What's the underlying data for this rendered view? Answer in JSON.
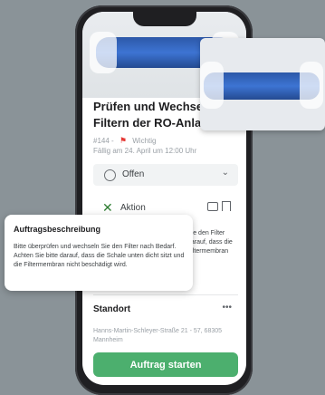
{
  "task": {
    "title": "Prüfen und Wechseln\nFiltern der RO-Anlage",
    "id": "#144",
    "separator": "-",
    "priority": "Wichtig",
    "due": "Fällig am 24. April um 12:00 Uhr",
    "status": "Offen",
    "action": "Aktion"
  },
  "description_peek": {
    "line1": "Sie den Filter",
    "line2": "darauf, dass die",
    "line3": "Filtermembran"
  },
  "location": {
    "title": "Standort",
    "dots": "•••",
    "address": "Hanns-Martin-Schleyer-Straße 21 - 57, 68305 Mannheim"
  },
  "cta": {
    "label": "Auftrag starten"
  },
  "popup": {
    "title": "Auftragsbeschreibung",
    "text": "Bitte überprüfen und wechseln Sie den Filter nach Bedarf. Achten Sie bitte darauf, dass die Schale unten dicht sitzt und die Filtermembran nicht beschädigt wird."
  },
  "icons": {
    "flag": "flag-icon",
    "circle": "circle-icon",
    "chevron": "chevron-down-icon",
    "tools": "tools-icon",
    "comment": "comment-icon",
    "bookmark": "bookmark-icon",
    "more": "more-dots-icon"
  },
  "colors": {
    "accent_green": "#4caf6e",
    "flag_red": "#e53935",
    "tools_green": "#2e7d32",
    "background": "#8a9398"
  }
}
